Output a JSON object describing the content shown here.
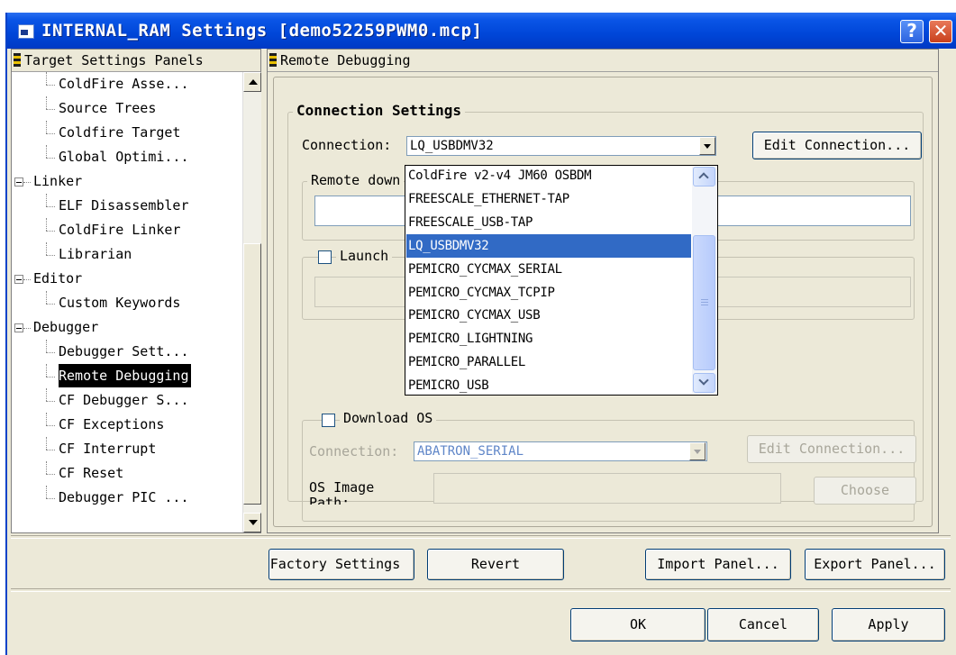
{
  "window": {
    "title": "INTERNAL_RAM Settings [demo52259PWM0.mcp]"
  },
  "left_panel": {
    "header": "Target Settings Panels",
    "items": [
      {
        "label": "ColdFire Asse...",
        "level": 1
      },
      {
        "label": "Source Trees",
        "level": 1
      },
      {
        "label": "Coldfire Target",
        "level": 1
      },
      {
        "label": "Global Optimi...",
        "level": 1
      },
      {
        "label": "Linker",
        "level": 0
      },
      {
        "label": "ELF Disassembler",
        "level": 1
      },
      {
        "label": "ColdFire Linker",
        "level": 1
      },
      {
        "label": "Librarian",
        "level": 1
      },
      {
        "label": "Editor",
        "level": 0
      },
      {
        "label": "Custom Keywords",
        "level": 1
      },
      {
        "label": "Debugger",
        "level": 0
      },
      {
        "label": "Debugger Sett...",
        "level": 1
      },
      {
        "label": "Remote Debugging",
        "level": 1,
        "selected": true
      },
      {
        "label": "CF Debugger S...",
        "level": 1
      },
      {
        "label": "CF Exceptions",
        "level": 1
      },
      {
        "label": "CF Interrupt",
        "level": 1
      },
      {
        "label": "CF Reset",
        "level": 1
      },
      {
        "label": "Debugger PIC ...",
        "level": 1
      }
    ]
  },
  "right_panel": {
    "header": "Remote Debugging",
    "connection_settings": {
      "group_label": "Connection Settings",
      "connection_label": "Connection:",
      "connection_value": "LQ_USBDMV32",
      "edit_button": "Edit Connection...",
      "remote_download_label": "Remote down",
      "launch_label": "Launch"
    },
    "download_os": {
      "group_label": "Download OS",
      "connection_label": "Connection:",
      "connection_value": "ABATRON_SERIAL",
      "edit_button": "Edit Connection...",
      "os_image_label": "OS Image",
      "os_image_label2": "Path:",
      "choose_button": "Choose"
    },
    "dropdown_options": [
      "ColdFire v2-v4 JM60 OSBDM",
      "FREESCALE_ETHERNET-TAP",
      "FREESCALE_USB-TAP",
      "LQ_USBDMV32",
      "PEMICRO_CYCMAX_SERIAL",
      "PEMICRO_CYCMAX_TCPIP",
      "PEMICRO_CYCMAX_USB",
      "PEMICRO_LIGHTNING",
      "PEMICRO_PARALLEL",
      "PEMICRO_USB"
    ],
    "dropdown_selected": "LQ_USBDMV32"
  },
  "buttons": {
    "factory_settings": "Factory Settings",
    "revert": "Revert",
    "import_panel": "Import Panel...",
    "export_panel": "Export Panel...",
    "ok": "OK",
    "cancel": "Cancel",
    "apply": "Apply"
  },
  "colors": {
    "titlebar": "#0046d8",
    "selection": "#316ac5",
    "dialog_bg": "#ece9d8"
  }
}
